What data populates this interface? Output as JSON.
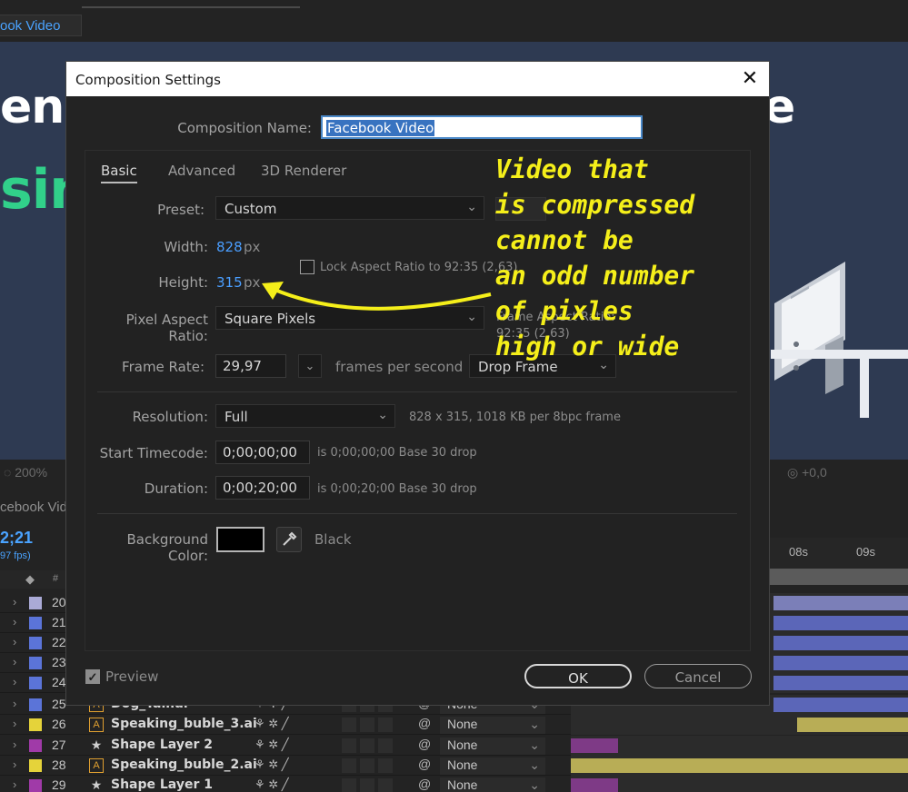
{
  "app": {
    "comp_tab": "ook Video",
    "viewer_zoom": "200%",
    "exposure": "+0,0",
    "timeline_tab": "cebook Vide",
    "current_time": "2;21",
    "fps": "97 fps)",
    "ruler_ticks": [
      "08s",
      "09s"
    ],
    "layers": [
      {
        "num": "20",
        "name": "",
        "color": "#aaaad6",
        "parent": "",
        "bar_color": "#7b7fb8",
        "bar_start": 0.6,
        "bar_end": 1.0
      },
      {
        "num": "21",
        "name": "",
        "color": "#5b74d8",
        "parent": "",
        "bar_color": "#5b66b8",
        "bar_start": 0.6,
        "bar_end": 1.0
      },
      {
        "num": "22",
        "name": "",
        "color": "#5b74d8",
        "parent": "",
        "bar_color": "#5b66b8",
        "bar_start": 0.6,
        "bar_end": 1.0
      },
      {
        "num": "23",
        "name": "",
        "color": "#5b74d8",
        "parent": "",
        "bar_color": "#5b66b8",
        "bar_start": 0.6,
        "bar_end": 1.0
      },
      {
        "num": "24",
        "name": "",
        "color": "#5b74d8",
        "parent": "",
        "bar_color": "#5b66b8",
        "bar_start": 0.6,
        "bar_end": 1.0
      },
      {
        "num": "25",
        "name": "Dog_Tail.ai",
        "color": "#5b74d8",
        "parent": "None",
        "type": "ai",
        "bar_color": "#5b66b8",
        "bar_start": 0.6,
        "bar_end": 1.0
      },
      {
        "num": "26",
        "name": "Speaking_buble_3.ai",
        "color": "#e5d33a",
        "parent": "None",
        "type": "ai",
        "bar_color": "#b8ad56",
        "bar_start": 0.67,
        "bar_end": 1.0
      },
      {
        "num": "27",
        "name": "Shape Layer 2",
        "color": "#a03aa8",
        "parent": "None",
        "type": "star",
        "bar_color": "#7e3a86",
        "bar_start": 0.0,
        "bar_end": 0.14
      },
      {
        "num": "28",
        "name": "Speaking_buble_2.ai",
        "color": "#e5d33a",
        "parent": "None",
        "type": "ai",
        "bar_color": "#b8ad56",
        "bar_start": 0.0,
        "bar_end": 1.0
      },
      {
        "num": "29",
        "name": "Shape Layer 1",
        "color": "#a03aa8",
        "parent": "None",
        "type": "star",
        "bar_color": "#7e3a86",
        "bar_start": 0.0,
        "bar_end": 0.14
      }
    ]
  },
  "dialog": {
    "title": "Composition Settings",
    "comp_name_label": "Composition Name:",
    "comp_name_value": "Facebook Video",
    "tabs": [
      "Basic",
      "Advanced",
      "3D Renderer"
    ],
    "preset_label": "Preset:",
    "preset_value": "Custom",
    "width_label": "Width:",
    "width_value": "828",
    "height_label": "Height:",
    "height_value": "315",
    "unit_px": "px",
    "lock_aspect_label": "Lock Aspect Ratio to 92:35 (2,63)",
    "lock_aspect_checked": false,
    "pixel_aspect_label": "Pixel Aspect Ratio:",
    "pixel_aspect_value": "Square Pixels",
    "frame_aspect_label": "Frame Aspect Ratio:",
    "frame_aspect_value": "92:35 (2,63)",
    "frame_rate_label": "Frame Rate:",
    "frame_rate_value": "29,97",
    "fps_label": "frames per second",
    "drop_frame_value": "Drop Frame",
    "resolution_label": "Resolution:",
    "resolution_value": "Full",
    "resolution_note": "828 x 315, 1018 KB per 8bpc frame",
    "start_tc_label": "Start Timecode:",
    "start_tc_value": "0;00;00;00",
    "start_tc_note": "is 0;00;00;00  Base 30  drop",
    "duration_label": "Duration:",
    "duration_value": "0;00;20;00",
    "duration_note": "is 0;00;20;00  Base 30  drop",
    "bg_color_label": "Background Color:",
    "bg_color_value": "#000000",
    "bg_color_name": "Black",
    "preview_label": "Preview",
    "preview_checked": true,
    "ok_label": "OK",
    "cancel_label": "Cancel"
  },
  "annotation": {
    "lines": [
      "Video that",
      "is compressed",
      "cannot be",
      "an odd number",
      "of pixles",
      "high or wide"
    ],
    "color": "#f5ef1a"
  },
  "preview_text": {
    "line1": "enu",
    "line2": "sin",
    "right_char": "e"
  },
  "icons": {
    "close": "close-icon",
    "dropdown": "chevron-down-icon",
    "eyedropper": "eyedropper-icon",
    "checkbox": "checkbox-icon",
    "ai_layer": "illustrator-file-icon",
    "shape_layer": "star-icon",
    "parent_link": "pickwhip-icon"
  }
}
